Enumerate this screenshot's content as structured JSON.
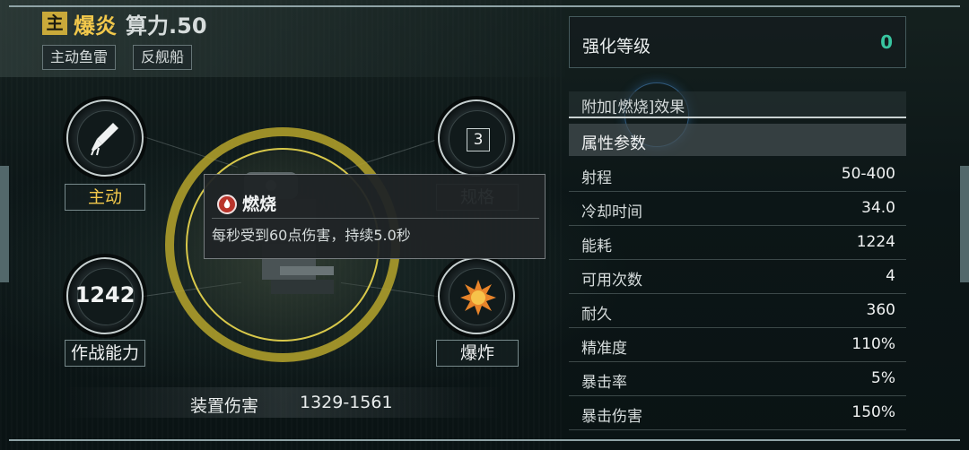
{
  "header": {
    "badge": "主",
    "weapon_name": "爆炎",
    "power_label": "算力.50",
    "tags": [
      "主动鱼雷",
      "反舰船"
    ]
  },
  "left": {
    "mode_label": "主动",
    "spec_value": "3",
    "spec_label": "规格",
    "combat_value": "1242",
    "combat_label": "作战能力",
    "damage_type_label": "爆炸",
    "device_damage_label": "装置伤害",
    "device_damage_value": "1329-1561"
  },
  "tooltip": {
    "title": "燃烧",
    "description": "每秒受到60点伤害，持续5.0秒"
  },
  "right": {
    "enhance_label": "强化等级",
    "enhance_value": "0",
    "effect_label": "附加[燃烧]效果",
    "attr_header": "属性参数",
    "attributes": [
      {
        "name": "射程",
        "value": "50-400"
      },
      {
        "name": "冷却时间",
        "value": "34.0"
      },
      {
        "name": "能耗",
        "value": "1224"
      },
      {
        "name": "可用次数",
        "value": "4"
      },
      {
        "name": "耐久",
        "value": "360"
      },
      {
        "name": "精准度",
        "value": "110%"
      },
      {
        "name": "暴击率",
        "value": "5%"
      },
      {
        "name": "暴击伤害",
        "value": "150%"
      }
    ]
  },
  "colors": {
    "accent_yellow": "#f2c84b",
    "enhance_green": "#38c5a0",
    "ring_gold": "#b6a52c"
  },
  "icons": {
    "mode": "torpedo-icon",
    "damage_type": "explosion-icon",
    "effect": "fire-icon"
  }
}
